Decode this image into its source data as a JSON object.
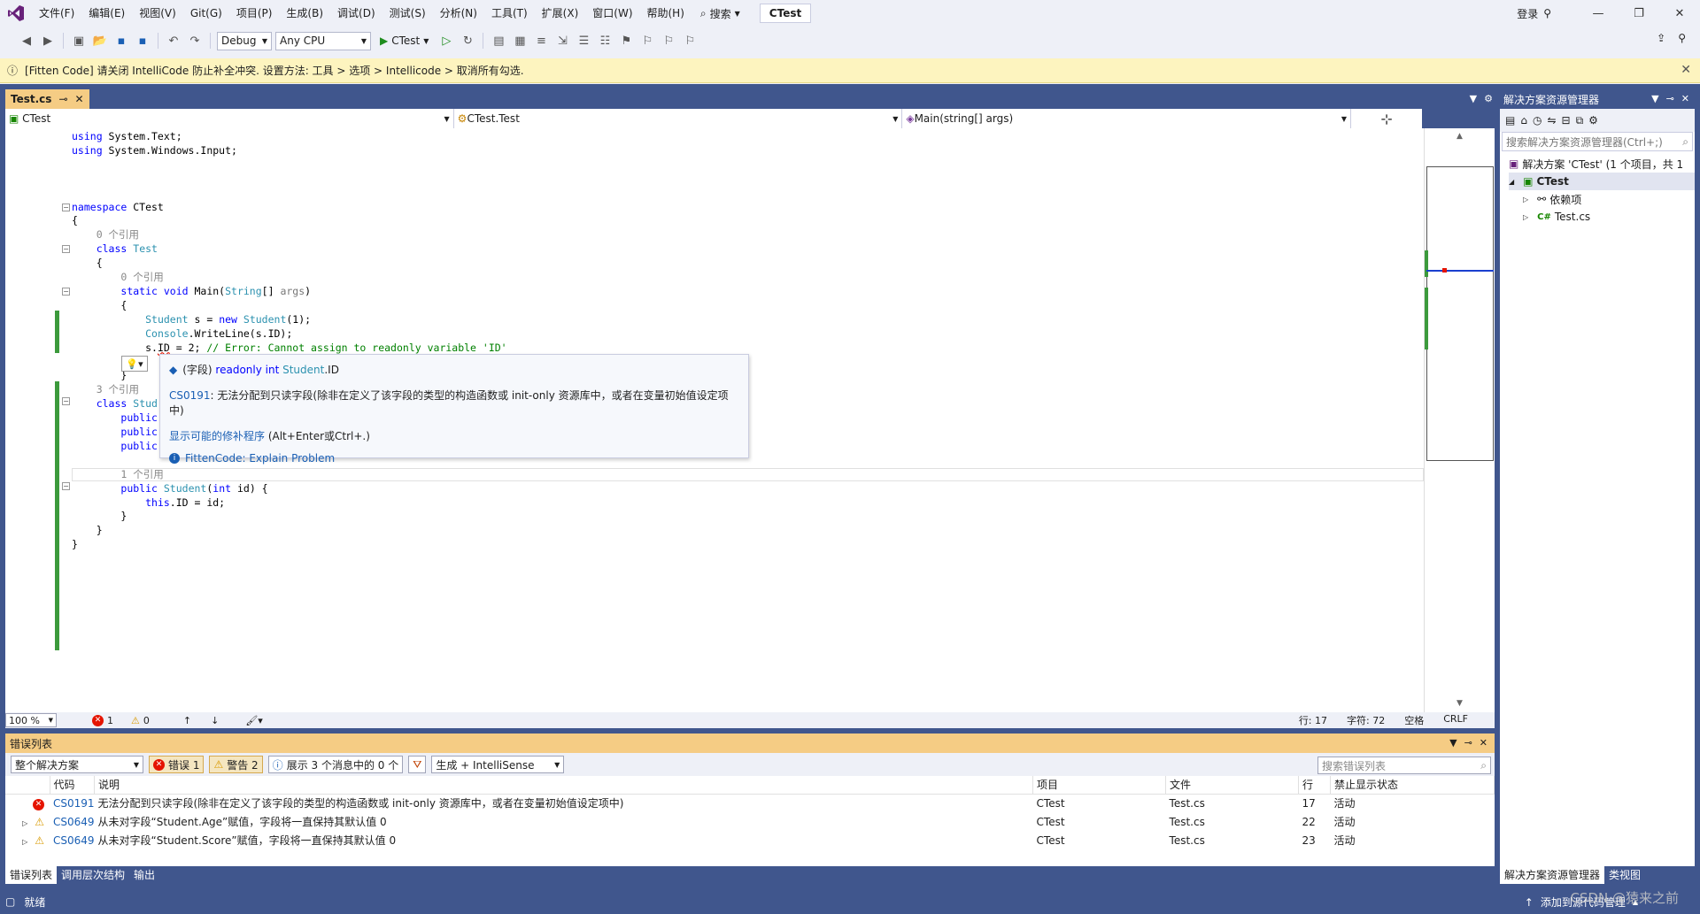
{
  "menu": {
    "items": [
      "文件(F)",
      "编辑(E)",
      "视图(V)",
      "Git(G)",
      "项目(P)",
      "生成(B)",
      "调试(D)",
      "测试(S)",
      "分析(N)",
      "工具(T)",
      "扩展(X)",
      "窗口(W)",
      "帮助(H)"
    ],
    "search_label": "搜索",
    "project_name": "CTest",
    "login_label": "登录"
  },
  "toolbar": {
    "config": "Debug",
    "platform": "Any CPU",
    "run_label": "CTest"
  },
  "infobar": {
    "text": "[Fitten Code] 请关闭 IntelliCode 防止补全冲突. 设置方法:   工具 > 选项 > Intellicode > 取消所有勾选."
  },
  "editor": {
    "tab_name": "Test.cs",
    "nav": {
      "project": "CTest",
      "class": "CTest.Test",
      "member": "Main(string[] args)"
    },
    "zoom": "100 %",
    "errors_count": "1",
    "warnings_count": "0",
    "line_label": "行: 17",
    "col_label": "字符: 72",
    "space_label": "空格",
    "eol_label": "CRLF"
  },
  "quickinfo": {
    "signature_prefix": "(字段) ",
    "signature_kw": "readonly int ",
    "signature_type": "Student",
    "signature_member": ".ID",
    "error_code": "CS0191",
    "error_text": ": 无法分配到只读字段(除非在定义了该字段的类型的构造函数或 init-only 资源库中，或者在变量初始值设定项中)",
    "fix_link": "显示可能的修补程序",
    "fix_shortcut": " (Alt+Enter或Ctrl+.)",
    "fitten_label": "FittenCode: Explain Problem"
  },
  "error_list": {
    "title": "错误列表",
    "scope": "整个解决方案",
    "errors_btn": "错误 1",
    "warnings_btn": "警告 2",
    "messages_btn": "展示 3 个消息中的 0 个",
    "build_filter": "生成 + IntelliSense",
    "search_placeholder": "搜索错误列表",
    "columns": [
      "代码",
      "说明",
      "项目",
      "文件",
      "行",
      "禁止显示状态"
    ],
    "rows": [
      {
        "severity": "error",
        "code": "CS0191",
        "desc": "无法分配到只读字段(除非在定义了该字段的类型的构造函数或 init-only 资源库中，或者在变量初始值设定项中)",
        "project": "CTest",
        "file": "Test.cs",
        "line": "17",
        "status": "活动"
      },
      {
        "severity": "warning",
        "code": "CS0649",
        "desc": "从未对字段“Student.Age”赋值，字段将一直保持其默认值 0",
        "project": "CTest",
        "file": "Test.cs",
        "line": "22",
        "status": "活动"
      },
      {
        "severity": "warning",
        "code": "CS0649",
        "desc": "从未对字段“Student.Score”赋值，字段将一直保持其默认值 0",
        "project": "CTest",
        "file": "Test.cs",
        "line": "23",
        "status": "活动"
      }
    ]
  },
  "bottom_tabs": [
    "错误列表",
    "调用层次结构",
    "输出"
  ],
  "solution_explorer": {
    "title": "解决方案资源管理器",
    "search_placeholder": "搜索解决方案资源管理器(Ctrl+;)",
    "solution_label": "解决方案 'CTest' (1 个项目，共 1",
    "project_label": "CTest",
    "deps_label": "依赖项",
    "file_label": "Test.cs",
    "tabs": [
      "解决方案资源管理器",
      "类视图"
    ]
  },
  "statusbar": {
    "ready": "就绪",
    "source_control": "添加到源代码管理",
    "watermark": "CSDN @猿来之前"
  },
  "colors": {
    "accent": "#40568d",
    "tab_active": "#f5cc84",
    "infobar": "#fdf4bf"
  }
}
